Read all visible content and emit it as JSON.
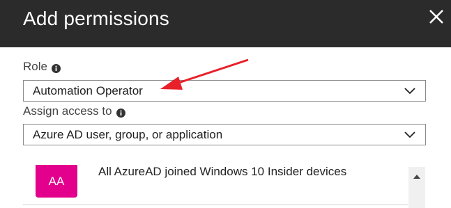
{
  "header": {
    "title": "Add permissions",
    "close_icon": "close-icon"
  },
  "role": {
    "label": "Role",
    "info_icon": "info-icon",
    "value": "Automation Operator"
  },
  "assign": {
    "label": "Assign access to",
    "info_icon": "info-icon",
    "value": "Azure AD user, group, or application"
  },
  "list": {
    "items": [
      {
        "initials": "AA",
        "title": "All AzureAD joined Windows 10 Insider devices",
        "avatar_color": "#e3008c"
      }
    ]
  },
  "colors": {
    "header_bg": "#2b2b2b",
    "annotation_arrow": "#e8202a"
  }
}
